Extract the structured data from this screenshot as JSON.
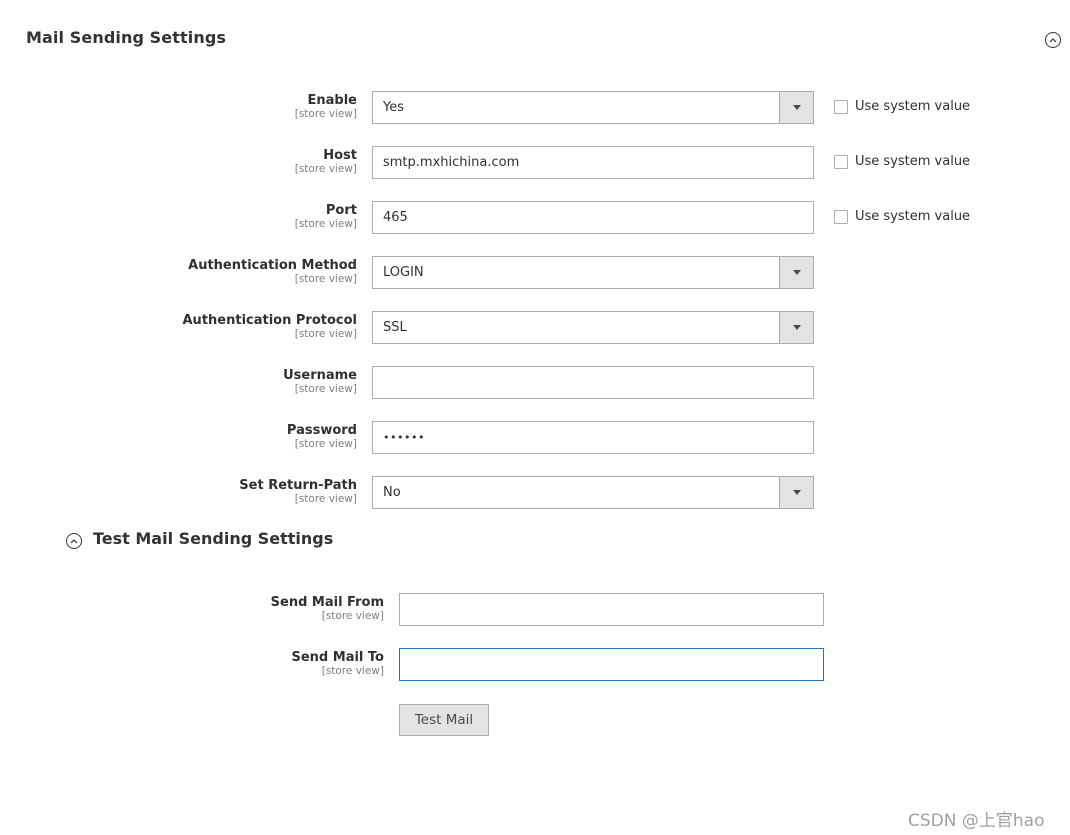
{
  "section": {
    "title": "Mail Sending Settings",
    "collapse_icon": "chevron-up-circle-icon"
  },
  "scope_label": "[store view]",
  "use_system_label": "Use system value",
  "fields": {
    "enable": {
      "label": "Enable",
      "value": "Yes"
    },
    "host": {
      "label": "Host",
      "value": "smtp.mxhichina.com"
    },
    "port": {
      "label": "Port",
      "value": "465"
    },
    "auth_method": {
      "label": "Authentication Method",
      "value": "LOGIN"
    },
    "auth_protocol": {
      "label": "Authentication Protocol",
      "value": "SSL"
    },
    "username": {
      "label": "Username",
      "value": ""
    },
    "password": {
      "label": "Password",
      "value": "••••••"
    },
    "return_path": {
      "label": "Set Return-Path",
      "value": "No"
    }
  },
  "test_section": {
    "title": "Test Mail Sending Settings",
    "collapse_icon": "chevron-up-circle-icon",
    "send_from": {
      "label": "Send Mail From",
      "value": ""
    },
    "send_to": {
      "label": "Send Mail To",
      "value": ""
    },
    "button_label": "Test Mail"
  },
  "watermark": "CSDN @上官hao"
}
